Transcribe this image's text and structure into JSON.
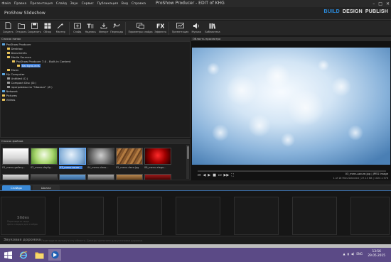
{
  "window": {
    "title": "ProShow Producer - EDIT of KHG",
    "minimize": "–",
    "maximize": "□",
    "close": "✕"
  },
  "menu": [
    "Файл",
    "Правка",
    "Презентация",
    "Слайд",
    "Звук",
    "Сервис",
    "Публикация",
    "Вид",
    "Справка"
  ],
  "app_name": "ProShow Slideshow",
  "modes": {
    "build": "BUILD",
    "design": "DESIGN",
    "publish": "PUBLISH",
    "active": "build"
  },
  "toolbar": [
    {
      "label": "Создать",
      "icon": "new-icon"
    },
    {
      "label": "Открыть",
      "icon": "open-icon"
    },
    {
      "label": "Сохранить",
      "icon": "save-icon"
    },
    {
      "label": "Обзор",
      "icon": "overview-icon"
    },
    {
      "label": "Мастер",
      "icon": "wizard-icon"
    },
    {
      "label": "Слайд",
      "icon": "slide-icon"
    },
    {
      "label": "Надпись",
      "icon": "caption-icon"
    },
    {
      "label": "Импорт",
      "icon": "import-icon"
    },
    {
      "label": "Переходы",
      "icon": "transitions-icon"
    },
    {
      "label": "Параметры слайда",
      "icon": "slide-options-icon"
    },
    {
      "label": "Эффекты",
      "icon": "fx-icon"
    },
    {
      "label": "Презентация",
      "icon": "show-icon"
    },
    {
      "label": "Музыка",
      "icon": "music-icon"
    },
    {
      "label": "Библиотека",
      "icon": "library-icon"
    }
  ],
  "folders": {
    "header": "Список папок",
    "items": [
      {
        "label": "ProShow Producer",
        "level": 0,
        "type": "app"
      },
      {
        "label": "Desktop",
        "level": 1,
        "type": "folder"
      },
      {
        "label": "Documents",
        "level": 1,
        "type": "folder"
      },
      {
        "label": "Media Sources",
        "level": 1,
        "type": "folder"
      },
      {
        "label": "ProShow Producer 7.0 - Built-in Content",
        "level": 2,
        "type": "folder"
      },
      {
        "label": "Backgrounds",
        "level": 3,
        "type": "folder",
        "selected": true
      },
      {
        "label": "Music",
        "level": 1,
        "type": "folder"
      },
      {
        "label": "My Computer",
        "level": 0,
        "type": "computer"
      },
      {
        "label": "Untitled (C:)",
        "level": 1,
        "type": "drive"
      },
      {
        "label": "Compact Disc (D:)",
        "level": 1,
        "type": "drive"
      },
      {
        "label": "программы на \"Vboxsvr\" (Z:)",
        "level": 1,
        "type": "drive"
      },
      {
        "label": "Network",
        "level": 0,
        "type": "network"
      },
      {
        "label": "Pictures",
        "level": 0,
        "type": "folder"
      },
      {
        "label": "Videos",
        "level": 0,
        "type": "folder"
      }
    ]
  },
  "files": {
    "header": "Список файлов",
    "items": [
      {
        "label": "01_menu-gallery...",
        "selected": false
      },
      {
        "label": "02_menu-daylig...",
        "selected": false
      },
      {
        "label": "03_menu-azure...",
        "selected": true
      },
      {
        "label": "04_menu-class...",
        "selected": false
      },
      {
        "label": "05_menu-deco.jpg",
        "selected": false
      },
      {
        "label": "06_menu-elega...",
        "selected": false
      }
    ]
  },
  "preview": {
    "header": "Область просмотра",
    "file_name": "03_menu-azure.jpg",
    "file_type": "JPEG Image",
    "selection_info": "1 of 16 Files Selected",
    "file_size": "27.13 KB",
    "dimensions": "1024 x 576",
    "transport": [
      "⏮",
      "◀",
      "▶",
      "■",
      "⏭",
      "▶▶",
      "⛶"
    ]
  },
  "timeline": {
    "tabs": [
      {
        "label": "Слайды",
        "active": true
      },
      {
        "label": "Шкала",
        "active": false
      }
    ],
    "empty_slide_title": "Slides",
    "empty_slide_hint1": "Перетащите сюда",
    "empty_slide_hint2": "фото и видео для слайда",
    "soundtrack_label": "Звуковая дорожка",
    "soundtrack_hint": "Перетащите музыку в эту область. Дважды щелкните для установки дорожки."
  },
  "taskbar": {
    "lang": "ENG",
    "time": "13:56",
    "date": "29.05.2015"
  },
  "colors": {
    "accent": "#2c8ddf",
    "taskbar": "#5b4a86",
    "selected": "#3b7bd6"
  }
}
